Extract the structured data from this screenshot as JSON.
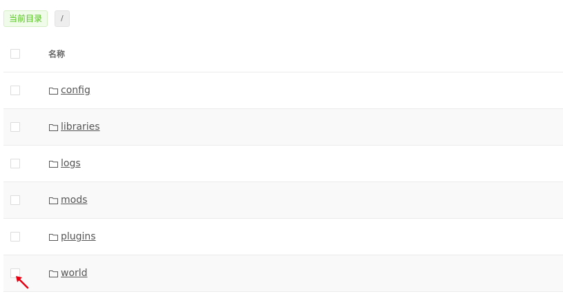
{
  "path_bar": {
    "current_dir_label": "当前目录",
    "path": "/"
  },
  "table": {
    "header": {
      "name_label": "名称"
    },
    "rows": [
      {
        "name": "config",
        "icon": "folder-icon"
      },
      {
        "name": "libraries",
        "icon": "folder-icon"
      },
      {
        "name": "logs",
        "icon": "folder-icon"
      },
      {
        "name": "mods",
        "icon": "folder-icon"
      },
      {
        "name": "plugins",
        "icon": "folder-icon"
      },
      {
        "name": "world",
        "icon": "folder-icon"
      }
    ]
  },
  "colors": {
    "tag_green": "#52c41a",
    "cursor_red": "#e60012"
  }
}
